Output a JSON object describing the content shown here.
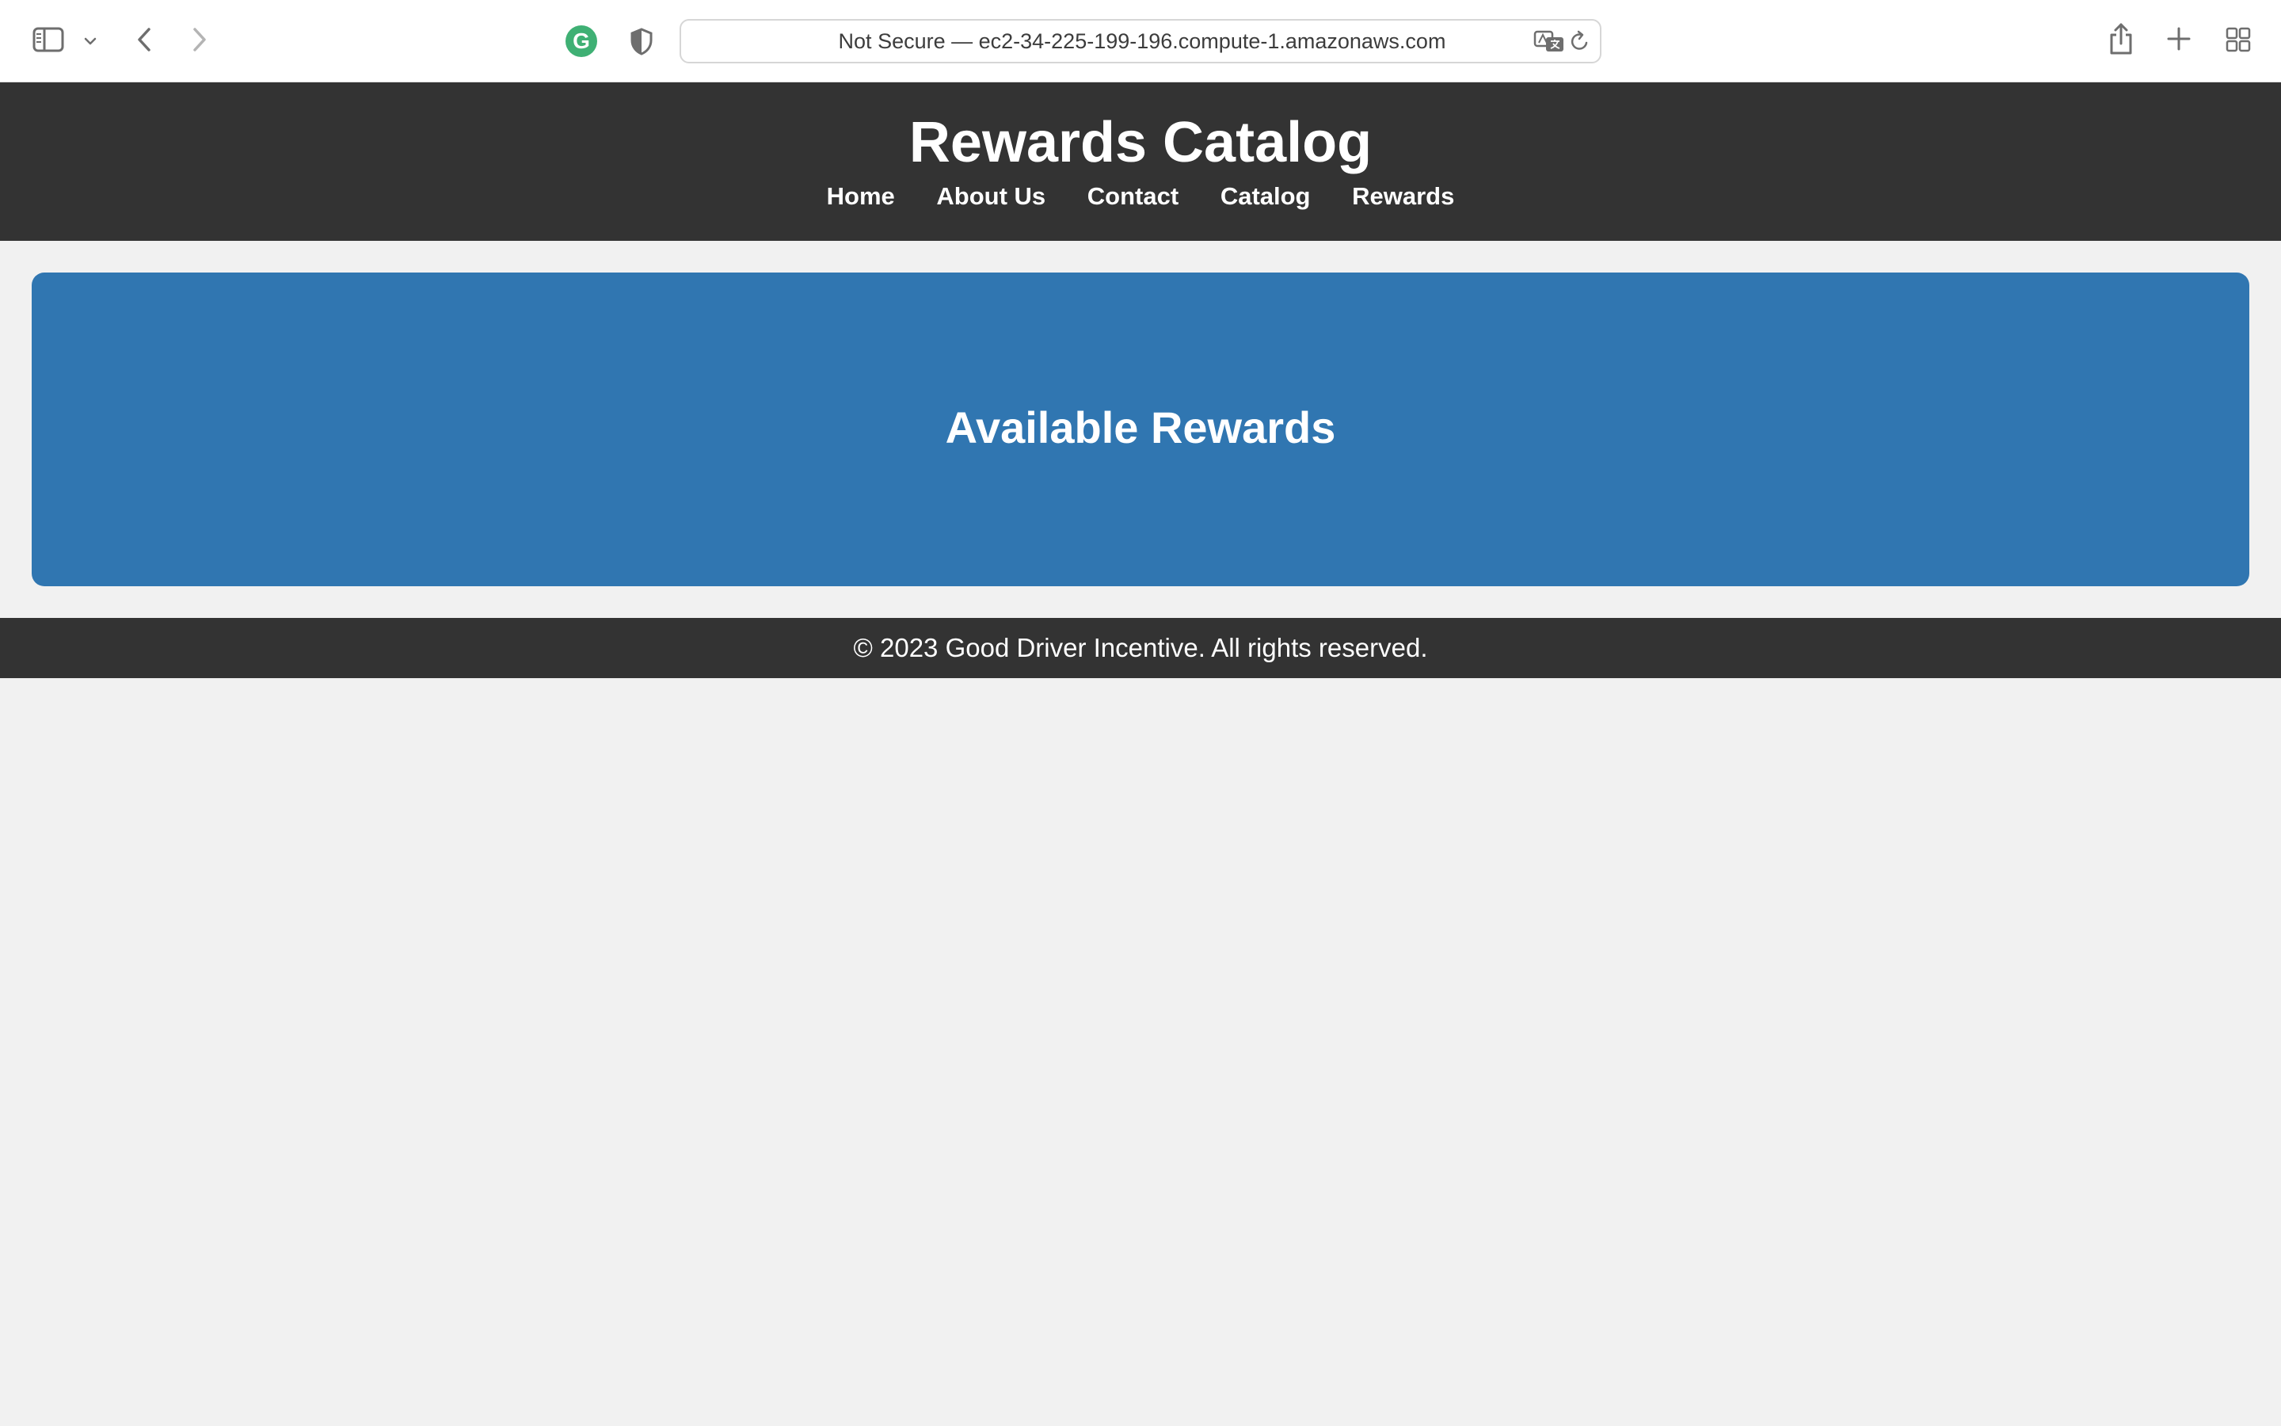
{
  "browser": {
    "address_bar": "Not Secure — ec2-34-225-199-196.compute-1.amazonaws.com",
    "icons": [
      "sidebar-icon",
      "chevron-down-icon",
      "back-icon",
      "forward-icon",
      "grammarly-icon",
      "shield-icon",
      "translate-icon",
      "reload-icon",
      "share-icon",
      "new-tab-icon",
      "tab-overview-icon"
    ],
    "grammarly_letter": "G"
  },
  "header": {
    "title": "Rewards Catalog",
    "nav": [
      "Home",
      "About Us",
      "Contact",
      "Catalog",
      "Rewards"
    ]
  },
  "main": {
    "banner_title": "Available Rewards"
  },
  "footer": {
    "text": "© 2023 Good Driver Incentive. All rights reserved."
  },
  "colors": {
    "header_bg": "#333333",
    "banner_bg": "#3076b1",
    "page_bg": "#f1f1f1"
  }
}
